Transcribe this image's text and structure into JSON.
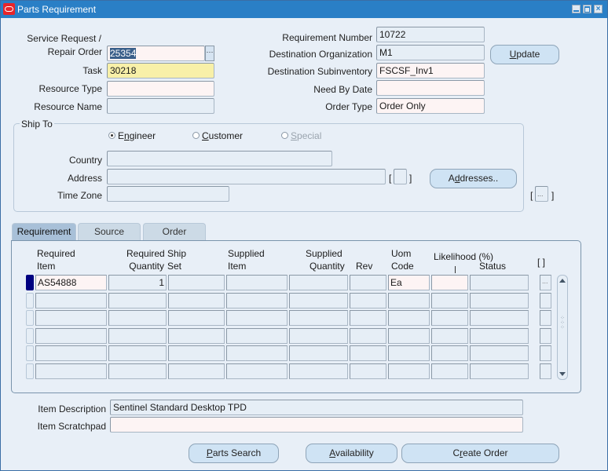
{
  "window": {
    "title": "Parts Requirement",
    "controls": [
      "minimize",
      "maximize",
      "close"
    ]
  },
  "header": {
    "service_request_label_line1": "Service Request /",
    "service_request_label_line2": "Repair Order",
    "service_request_value": "25354",
    "task_label": "Task",
    "task_value": "30218",
    "resource_type_label": "Resource Type",
    "resource_type_value": "",
    "resource_name_label": "Resource Name",
    "resource_name_value": "",
    "requirement_number_label": "Requirement Number",
    "requirement_number_value": "10722",
    "dest_org_label": "Destination Organization",
    "dest_org_value": "M1",
    "dest_subinv_label": "Destination Subinventory",
    "dest_subinv_value": "FSCSF_Inv1",
    "need_by_label": "Need By Date",
    "need_by_value": "",
    "order_type_label": "Order Type",
    "order_type_value": "Order Only",
    "update_button": {
      "mnemonic": "U",
      "rest": "pdate"
    }
  },
  "ship_to": {
    "title": "Ship To",
    "radios": [
      {
        "mnemonic_pre": "E",
        "mnemonic": "n",
        "rest": "gineer",
        "selected": true,
        "enabled": true
      },
      {
        "mnemonic_pre": "",
        "mnemonic": "C",
        "rest": "ustomer",
        "selected": false,
        "enabled": true
      },
      {
        "mnemonic_pre": "",
        "mnemonic": "S",
        "rest": "pecial",
        "selected": false,
        "enabled": false
      }
    ],
    "country_label": "Country",
    "country_value": "",
    "address_label": "Address",
    "address_value": "",
    "timezone_label": "Time Zone",
    "timezone_value": "",
    "addresses_button": {
      "pre": "A",
      "mnemonic": "d",
      "rest": "dresses.."
    }
  },
  "tabs": [
    {
      "label": "Requirement",
      "active": true
    },
    {
      "label": "Source",
      "active": false
    },
    {
      "label": "Order",
      "active": false
    }
  ],
  "table": {
    "headers": {
      "required_item": [
        "Required",
        "Item"
      ],
      "required_qty": [
        "Required",
        "Quantity"
      ],
      "ship_set": [
        "Ship",
        "Set"
      ],
      "supplied_item": [
        "Supplied",
        "Item"
      ],
      "supplied_qty": [
        "Supplied",
        "Quantity"
      ],
      "rev": "Rev",
      "uom": [
        "Uom",
        "Code"
      ],
      "likelihood": "Likelihood (%)",
      "status": "Status",
      "flex": "[ ]"
    },
    "rows": [
      {
        "required_item": "AS54888",
        "required_qty": "1",
        "ship_set": "",
        "supplied_item": "",
        "supplied_qty": "",
        "rev": "",
        "uom": "Ea",
        "likelihood": "",
        "status": "",
        "current": true
      },
      {
        "required_item": "",
        "required_qty": "",
        "ship_set": "",
        "supplied_item": "",
        "supplied_qty": "",
        "rev": "",
        "uom": "",
        "likelihood": "",
        "status": "",
        "current": false
      },
      {
        "required_item": "",
        "required_qty": "",
        "ship_set": "",
        "supplied_item": "",
        "supplied_qty": "",
        "rev": "",
        "uom": "",
        "likelihood": "",
        "status": "",
        "current": false
      },
      {
        "required_item": "",
        "required_qty": "",
        "ship_set": "",
        "supplied_item": "",
        "supplied_qty": "",
        "rev": "",
        "uom": "",
        "likelihood": "",
        "status": "",
        "current": false
      },
      {
        "required_item": "",
        "required_qty": "",
        "ship_set": "",
        "supplied_item": "",
        "supplied_qty": "",
        "rev": "",
        "uom": "",
        "likelihood": "",
        "status": "",
        "current": false
      },
      {
        "required_item": "",
        "required_qty": "",
        "ship_set": "",
        "supplied_item": "",
        "supplied_qty": "",
        "rev": "",
        "uom": "",
        "likelihood": "",
        "status": "",
        "current": false
      }
    ]
  },
  "footer": {
    "item_description_label": "Item Description",
    "item_description_value": "Sentinel Standard Desktop TPD",
    "item_scratchpad_label": "Item Scratchpad",
    "item_scratchpad_value": "",
    "parts_search_button": {
      "mnemonic": "P",
      "rest": "arts Search"
    },
    "availability_button": {
      "mnemonic": "A",
      "rest": "vailability"
    },
    "create_order_button": {
      "pre": "C",
      "mnemonic": "r",
      "rest": "eate Order"
    }
  },
  "misc": {
    "lov_glyph": "...",
    "bracket_open": "[",
    "bracket_close": "]"
  }
}
